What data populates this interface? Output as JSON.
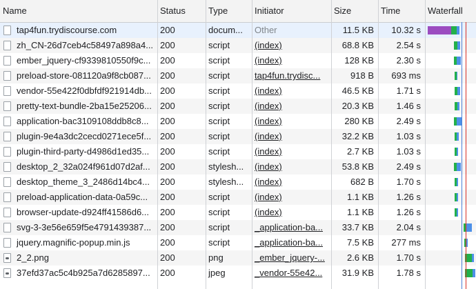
{
  "columns": {
    "name": "Name",
    "status": "Status",
    "type": "Type",
    "initiator": "Initiator",
    "size": "Size",
    "time": "Time",
    "waterfall": "Waterfall"
  },
  "colors": {
    "queue": "#9b4cc0",
    "wait": "#23b04a",
    "download": "#4d90e8",
    "dom_line": "#4a7fd6",
    "load_line": "#d93025"
  },
  "rows": [
    {
      "name": "tap4fun.trydiscourse.com",
      "status": "200",
      "type": "docum...",
      "initiator": "Other",
      "initiator_style": "other",
      "size": "11.5 KB",
      "time": "10.32 s",
      "icon": "file-icon"
    },
    {
      "name": "zh_CN-26d7ceb4c58497a898a4...",
      "status": "200",
      "type": "script",
      "initiator": "(index)",
      "initiator_style": "link",
      "size": "68.8 KB",
      "time": "2.54 s",
      "icon": "file-icon"
    },
    {
      "name": "ember_jquery-cf9339810550f9c...",
      "status": "200",
      "type": "script",
      "initiator": "(index)",
      "initiator_style": "link",
      "size": "128 KB",
      "time": "2.30 s",
      "icon": "file-icon"
    },
    {
      "name": "preload-store-081120a9f8cb087...",
      "status": "200",
      "type": "script",
      "initiator": "tap4fun.trydisc...",
      "initiator_style": "link",
      "size": "918 B",
      "time": "693 ms",
      "icon": "file-icon"
    },
    {
      "name": "vendor-55e422f0dbfdf921914db...",
      "status": "200",
      "type": "script",
      "initiator": "(index)",
      "initiator_style": "link",
      "size": "46.5 KB",
      "time": "1.71 s",
      "icon": "file-icon"
    },
    {
      "name": "pretty-text-bundle-2ba15e25206...",
      "status": "200",
      "type": "script",
      "initiator": "(index)",
      "initiator_style": "link",
      "size": "20.3 KB",
      "time": "1.46 s",
      "icon": "file-icon"
    },
    {
      "name": "application-bac3109108ddb8c8...",
      "status": "200",
      "type": "script",
      "initiator": "(index)",
      "initiator_style": "link",
      "size": "280 KB",
      "time": "2.49 s",
      "icon": "file-icon"
    },
    {
      "name": "plugin-9e4a3dc2cecd0271ece5f...",
      "status": "200",
      "type": "script",
      "initiator": "(index)",
      "initiator_style": "link",
      "size": "32.2 KB",
      "time": "1.03 s",
      "icon": "file-icon"
    },
    {
      "name": "plugin-third-party-d4986d1ed35...",
      "status": "200",
      "type": "script",
      "initiator": "(index)",
      "initiator_style": "link",
      "size": "2.7 KB",
      "time": "1.03 s",
      "icon": "file-icon"
    },
    {
      "name": "desktop_2_32a024f961d07d2af...",
      "status": "200",
      "type": "stylesh...",
      "initiator": "(index)",
      "initiator_style": "link",
      "size": "53.8 KB",
      "time": "2.49 s",
      "icon": "file-icon"
    },
    {
      "name": "desktop_theme_3_2486d14bc4...",
      "status": "200",
      "type": "stylesh...",
      "initiator": "(index)",
      "initiator_style": "link",
      "size": "682 B",
      "time": "1.70 s",
      "icon": "file-icon"
    },
    {
      "name": "preload-application-data-0a59c...",
      "status": "200",
      "type": "script",
      "initiator": "(index)",
      "initiator_style": "link",
      "size": "1.1 KB",
      "time": "1.26 s",
      "icon": "file-icon"
    },
    {
      "name": "browser-update-d924ff41586d6...",
      "status": "200",
      "type": "script",
      "initiator": "(index)",
      "initiator_style": "link",
      "size": "1.1 KB",
      "time": "1.26 s",
      "icon": "file-icon"
    },
    {
      "name": "svg-3-3e56e659f5e4791439387...",
      "status": "200",
      "type": "script",
      "initiator": "_application-ba...",
      "initiator_style": "link",
      "size": "33.7 KB",
      "time": "2.04 s",
      "icon": "file-icon"
    },
    {
      "name": "jquery.magnific-popup.min.js",
      "status": "200",
      "type": "script",
      "initiator": "_application-ba...",
      "initiator_style": "link",
      "size": "7.5 KB",
      "time": "277 ms",
      "icon": "file-icon"
    },
    {
      "name": "2_2.png",
      "status": "200",
      "type": "png",
      "initiator": "_ember_jquery-...",
      "initiator_style": "link",
      "size": "2.6 KB",
      "time": "1.70 s",
      "icon": "image-icon"
    },
    {
      "name": "37efd37ac5c4b925a7d6285897...",
      "status": "200",
      "type": "jpeg",
      "initiator": "_vendor-55e42...",
      "initiator_style": "link",
      "size": "31.9 KB",
      "time": "1.78 s",
      "icon": "image-icon"
    }
  ]
}
